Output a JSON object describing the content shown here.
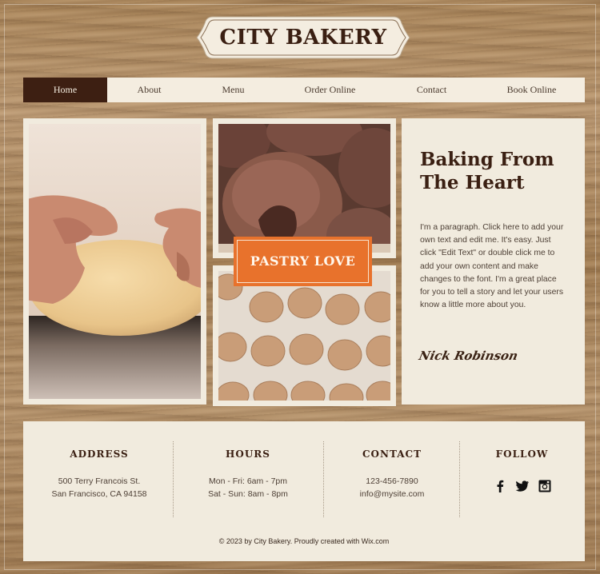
{
  "site": {
    "logo_text": "CITY BAKERY"
  },
  "nav": {
    "items": [
      {
        "label": "Home",
        "active": true
      },
      {
        "label": "About",
        "active": false
      },
      {
        "label": "Menu",
        "active": false
      },
      {
        "label": "Order Online",
        "active": false
      },
      {
        "label": "Contact",
        "active": false
      },
      {
        "label": "Book Online",
        "active": false
      }
    ]
  },
  "gallery": {
    "badge_label": "PASTRY LOVE"
  },
  "intro": {
    "heading": "Baking From The Heart",
    "paragraph": "I'm a paragraph. Click here to add your own text and edit me. It's easy. Just click \"Edit Text\" or double click me to add your own content and make changes to the font. I'm a great place for you to tell a story and let your users know a little more about you.",
    "signature": "Nick Robinson"
  },
  "footer": {
    "address": {
      "title": "ADDRESS",
      "line1": "500 Terry Francois St.",
      "line2": "San Francisco, CA 94158"
    },
    "hours": {
      "title": "HOURS",
      "line1": "Mon - Fri: 6am - 7pm",
      "line2": "Sat - Sun: 8am - 8pm"
    },
    "contact": {
      "title": "CONTACT",
      "line1": "123-456-7890",
      "line2": "info@mysite.com"
    },
    "follow": {
      "title": "FOLLOW",
      "icons": [
        "facebook-icon",
        "twitter-icon",
        "instagram-icon"
      ]
    },
    "copyright": "© 2023 by City Bakery. Proudly created with Wix.com"
  },
  "colors": {
    "brand_dark": "#3d1f12",
    "accent_orange": "#e8722c",
    "panel": "#f1ebde"
  }
}
